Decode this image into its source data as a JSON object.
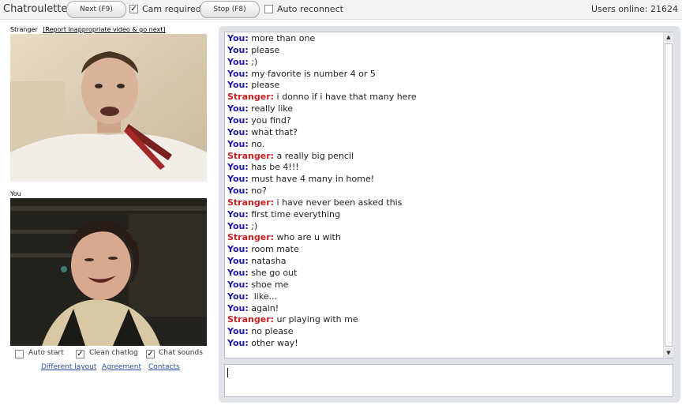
{
  "app_title": "Chatroulette",
  "toolbar": {
    "next_label": "Next (F9)",
    "cam_required_label": "Cam required",
    "cam_required_checked": "✓",
    "stop_label": "Stop (F8)",
    "auto_reconnect_label": "Auto reconnect",
    "users_online": "Users online: 21624"
  },
  "stranger_header": "Stranger",
  "report_link": "[Report inappropriate video & go next]",
  "you_header": "You",
  "options": {
    "auto_start_label": "Auto start",
    "clean_chatlog_label": "Clean chatlog",
    "clean_chatlog_checked": "✓",
    "chat_sounds_label": "Chat sounds",
    "chat_sounds_checked": "✓"
  },
  "footer_links": {
    "different_layout": "Different layout",
    "agreement": "Agreement",
    "contacts": "Contacts"
  },
  "chat": {
    "messages": [
      {
        "who": "You:",
        "text": "more than one"
      },
      {
        "who": "You:",
        "text": "please"
      },
      {
        "who": "You:",
        "text": ";)"
      },
      {
        "who": "You:",
        "text": "my favorite is number 4 or 5"
      },
      {
        "who": "You:",
        "text": "please"
      },
      {
        "who": "Stranger:",
        "text": "i donno if i have that many here"
      },
      {
        "who": "You:",
        "text": "really like"
      },
      {
        "who": "You:",
        "text": "you find?"
      },
      {
        "who": "You:",
        "text": "what that?"
      },
      {
        "who": "You:",
        "text": "no."
      },
      {
        "who": "Stranger:",
        "text": "a really big pencil"
      },
      {
        "who": "You:",
        "text": "has be 4!!!"
      },
      {
        "who": "You:",
        "text": "must have 4 many in home!"
      },
      {
        "who": "You:",
        "text": "no?"
      },
      {
        "who": "Stranger:",
        "text": "i have never been asked this"
      },
      {
        "who": "You:",
        "text": "first time everything"
      },
      {
        "who": "You:",
        "text": ";)"
      },
      {
        "who": "Stranger:",
        "text": "who are u with"
      },
      {
        "who": "You:",
        "text": "room mate"
      },
      {
        "who": "You:",
        "text": "natasha"
      },
      {
        "who": "You:",
        "text": "she go out"
      },
      {
        "who": "You:",
        "text": "shoe me"
      },
      {
        "who": "You:",
        "text": " like..."
      },
      {
        "who": "You:",
        "text": "again!"
      },
      {
        "who": "Stranger:",
        "text": "ur playing with me"
      },
      {
        "who": "You:",
        "text": "no please"
      },
      {
        "who": "You:",
        "text": "other way!"
      }
    ],
    "input_value": ""
  },
  "icons": {
    "scroll_up": "scroll-up-arrow-icon",
    "scroll_down": "scroll-down-arrow-icon"
  }
}
